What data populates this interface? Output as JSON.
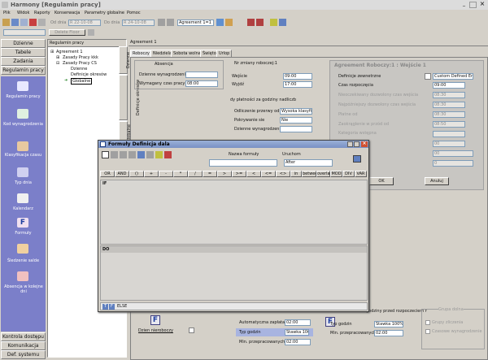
{
  "window": {
    "title": "Harmony [Regulamin pracy]"
  },
  "menu": [
    "Plik",
    "Widok",
    "Raporty",
    "Konserwacja",
    "Parametry globalne",
    "Pomoc"
  ],
  "toolbar": {
    "date_from_label": "Od dnia",
    "date_from_value": "R 22-10-08",
    "date_to_label": "Do dnia",
    "date_to_value": "R 24-10-08",
    "agreement_select": "Agreement 1=1",
    "delete_floor": "Delete Floor"
  },
  "nav": {
    "top": [
      "Dzienne",
      "Tabele",
      "Zadania",
      "Regulamin pracy"
    ],
    "items": [
      {
        "label": "Regulamin pracy",
        "icon": "rules-icon"
      },
      {
        "label": "Kod wynagrodzenia",
        "icon": "pay-code-icon"
      },
      {
        "label": "Klasyfikacja czasu",
        "icon": "time-class-icon"
      },
      {
        "label": "Typ dnia",
        "icon": "day-type-icon"
      },
      {
        "label": "Kalendarz",
        "icon": "calendar-icon"
      },
      {
        "label": "Formuły",
        "icon": "formula-icon"
      },
      {
        "label": "Śledzenie salde",
        "icon": "balance-tracking-icon"
      },
      {
        "label": "Absencja w kolejne dni",
        "icon": "absence-icon"
      }
    ],
    "bottom": [
      "Kontrola dostępu",
      "Komunikacja",
      "Def. systemu"
    ]
  },
  "tree": {
    "header": "Regulamin pracy",
    "nodes": [
      "Agreement 1",
      "Zasady Pracy kkk",
      "Zasady Pracy CS",
      "Dzienne",
      "Definicje okresów",
      "Globalne"
    ]
  },
  "main": {
    "header": "Agreement 1",
    "tabs": [
      "Roboczy",
      "Niedziela",
      "Sobota wolna",
      "Święto",
      "Urlop"
    ],
    "vtabs": [
      "Dzienne",
      "Definicje okresów",
      "Globalne"
    ],
    "absencja": {
      "title": "Absencja",
      "dzienne_label": "Dzienne wynagrodzenie",
      "wymagany_label": "Wymagany czas pracy",
      "wymagany_value": "08:00"
    },
    "zmiany": {
      "title": "Nr zmiany roboczej:1",
      "wejscie_label": "Wejście",
      "wejscie_value": "09:00",
      "wyjscie_label": "Wyjdź",
      "wyjscie_value": "17:00",
      "platnosc_label": "dy płatności za godziny nadliczb",
      "odliczenie_label": "Odliczenie przerwy od",
      "odliczenie_value": "Wysoka klasyfik",
      "pokrywanie_label": "Pokrywanie sie",
      "pokrywanie_value": "Nie",
      "dzienne_label": "Dzienne wynagrodzenie",
      "zaokraglenie_label": "Zaokrąglenie"
    },
    "right_panel": {
      "title": "Agreement Roboczy:1 : Wejście 1",
      "definicje_label": "Definicje zewnetrzne",
      "definicje_value": "Custom Defined Entr",
      "czas_label": "Czas rozpoczęcia",
      "czas_value": "09:00",
      "rows": [
        {
          "label": "Nieoczekiwany dozwolony czas wejścia",
          "value": "08:30"
        },
        {
          "label": "Najpóźniejszy dozwolony czas wejścia",
          "value": "08:30"
        },
        {
          "label": "Płatne od",
          "value": "08:30"
        },
        {
          "label": "Zaokrąglenie w przód od",
          "value": "08:50"
        },
        {
          "label": "Kategoria wstępna",
          "value": ""
        },
        {
          "label": "",
          "value": "00"
        },
        {
          "label": "",
          "value": "00"
        },
        {
          "label": "",
          "value": "0"
        }
      ],
      "ok": "OK",
      "cancel": "Anuluj"
    },
    "lower": {
      "dzien_label": "Dzien nieroboczy",
      "auto_label": "Automatyczna zapłata",
      "auto_value": "02:00",
      "typ_label": "Typ godzin",
      "typ_value": "Stawka 100",
      "min_label": "Min. przepracowanych g",
      "min_value": "02:00",
      "typ2_label": "Typ godzin",
      "typ2_value": "Stawka 100%",
      "min2_label": "Min. przepracowanych g",
      "min2_value": "02:00",
      "nadgodziny_label": "Nadgodziny przed rozpoczeciem r",
      "right_title": "Grupa dolna",
      "right_r1": "Grupy zliczenia",
      "right_r2": "Czasowe wynagrodzenie"
    }
  },
  "dialog": {
    "title": "Formuły   Definicja dala",
    "nazwa_label": "Nazwa formuły",
    "uruchom_label": "Uruchom",
    "uruchom_value": "After",
    "ops": [
      "OR",
      "AND",
      "()",
      "+",
      "-",
      "*",
      "/",
      "=",
      ">",
      ">=",
      "<",
      "<=",
      "<>",
      "in",
      "between",
      "overlap",
      "MOD",
      "DIV",
      "VAR"
    ],
    "if_label": "IF",
    "do_label": "DO",
    "else_label": "ELSE"
  }
}
